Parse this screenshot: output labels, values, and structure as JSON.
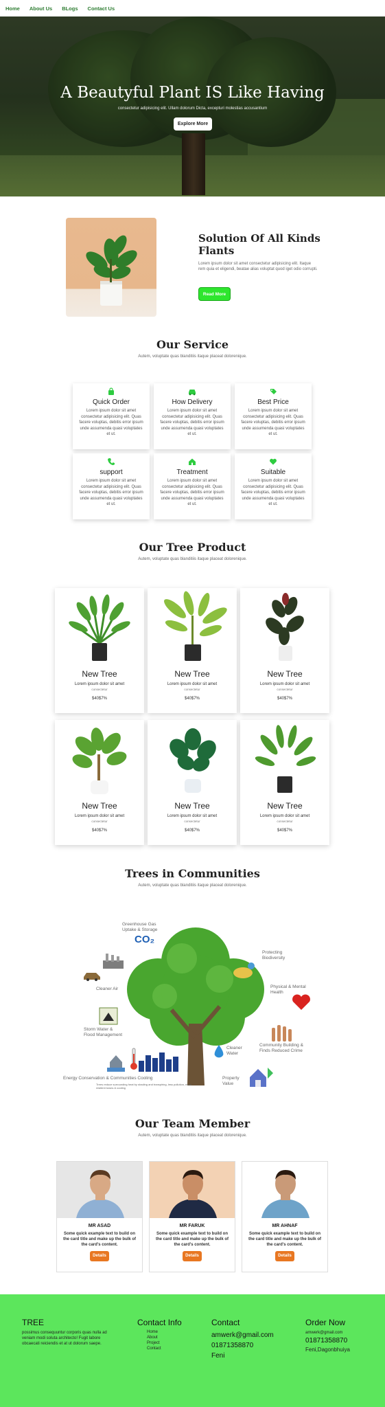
{
  "nav": {
    "items": [
      "Home",
      "About Us",
      "BLogs",
      "Contact Us"
    ]
  },
  "hero": {
    "title": "A Beautyful Plant IS Like Having",
    "subtitle": "consectetur adipisicing elit. Ullam dolorum Dicta, excepturi molestias accusantium",
    "button": "Explore More"
  },
  "solution": {
    "title": "Solution Of All Kinds Flants",
    "text": "Lorem ipsum dolor sit amet consectetur adipisicing elit. Itaque rem quia et eligendi, beatae alias voluptat quod iget odio corrupti.",
    "button": "Read More"
  },
  "services": {
    "title": "Our Service",
    "subtitle": "Autem, voluptate quas blanditiis itaque placeat dolorenique.",
    "items": [
      {
        "title": "Quick Order",
        "icon": "bag-icon",
        "text": "Lorem ipsum dolor sit amet consectetur adipisicing elit. Quas facere voluptas, debitis error ipsum unde assumenda quasi voluptates et ut."
      },
      {
        "title": "How Delivery",
        "icon": "car-icon",
        "text": "Lorem ipsum dolor sit amet consectetur adipisicing elit. Quas facere voluptas, debitis error ipsum unde assumenda quasi voluptates et ut."
      },
      {
        "title": "Best Price",
        "icon": "tag-icon",
        "text": "Lorem ipsum dolor sit amet consectetur adipisicing elit. Quas facere voluptas, debitis error ipsum unde assumenda quasi voluptates et ut."
      },
      {
        "title": "support",
        "icon": "phone-icon",
        "text": "Lorem ipsum dolor sit amet consectetur adipisicing elit. Quas facere voluptas, debitis error ipsum unde assumenda quasi voluptates et ut."
      },
      {
        "title": "Treatment",
        "icon": "home-icon",
        "text": "Lorem ipsum dolor sit amet consectetur adipisicing elit. Quas facere voluptas, debitis error ipsum unde assumenda quasi voluptates et ut."
      },
      {
        "title": "Suitable",
        "icon": "heart-icon",
        "text": "Lorem ipsum dolor sit amet consectetur adipisicing elit. Quas facere voluptas, debitis error ipsum unde assumenda quasi voluptates et ut."
      }
    ]
  },
  "products": {
    "title": "Our Tree Product",
    "subtitle": "Autem, voluptate quas blanditiis itaque placeat dolorenique.",
    "items": [
      {
        "name": "New Tree",
        "desc": "Lorem ipsum dolor sit amet",
        "desc2": "consectetur",
        "price": "$40$7%"
      },
      {
        "name": "New Tree",
        "desc": "Lorem ipsum dolor sit amet",
        "desc2": "consectetur",
        "price": "$40$7%"
      },
      {
        "name": "New Tree",
        "desc": "Lorem ipsum dolor sit amet",
        "desc2": "consectetur",
        "price": "$40$7%"
      },
      {
        "name": "New Tree",
        "desc": "Lorem ipsum dolor sit amet",
        "desc2": "consectetur",
        "price": "$40$7%"
      },
      {
        "name": "New Tree",
        "desc": "Lorem ipsum dolor sit amet",
        "desc2": "consectetur",
        "price": "$40$7%"
      },
      {
        "name": "New Tree",
        "desc": "Lorem ipsum dolor sit amet",
        "desc2": "consectetur",
        "price": "$40$7%"
      }
    ]
  },
  "communities": {
    "title": "Trees in Communities",
    "subtitle": "Autem, voluptate quas blanditiis itaque placeat dolorenique.",
    "labels": {
      "greenhouse": "Greenhouse Gas\nUptake & Storage",
      "co2": "CO₂",
      "protecting": "Protecting\nBiodiversity",
      "cleaner_air": "Cleaner Air",
      "physical": "Physical & Mental\nHealth",
      "storm": "Storm Water &\nFlood Management",
      "cleaner_water": "Cleaner\nWater",
      "community": "Community Building &\nFinds Reduced Crime",
      "energy": "Energy Conservation & Communities Cooling",
      "energy_note": "Trees reduce surrounding heat by shading and transpiring, less pollution, more resilient towns & cooling",
      "property": "Property\nValue"
    }
  },
  "team": {
    "title": "Our Team Member",
    "subtitle": "Autem, voluptate quas blanditiis itaque placeat dolorenique.",
    "members": [
      {
        "name": "MR ASAD",
        "text": "Some quick example text to build on the card title and make up the bulk of the card's content.",
        "button": "Details"
      },
      {
        "name": "MR FARUK",
        "text": "Some quick example text to build on the card title and make up the bulk of the card's content.",
        "button": "Details"
      },
      {
        "name": "MR AHNAF",
        "text": "Some quick example text to build on the card title and make up the bulk of the card's content.",
        "button": "Details"
      }
    ]
  },
  "footer": {
    "brand": "TREE",
    "brand_text": "possimus consequuntur corporis quas nulla ad veniam modi soluta architecto! Fugit labore obcaecati reiciendis et at ut dolorum saepe.",
    "contact_info_title": "Contact Info",
    "contact_links": [
      "Home",
      "About",
      "Project",
      "Contact"
    ],
    "contact_title": "Contact",
    "contact_email": "amwerk@gmail.com",
    "contact_phone": "01871358870",
    "contact_city": "Feni",
    "order_title": "Order Now",
    "order_email": "amwerk@gmail.com",
    "order_phone": "01871358870",
    "order_address": "Feni,Dagonbhuiya"
  },
  "colors": {
    "accent_green": "#2ee62e",
    "footer_green": "#5ce65c",
    "detail_orange": "#e87722",
    "nav_green": "#2e7d32"
  }
}
